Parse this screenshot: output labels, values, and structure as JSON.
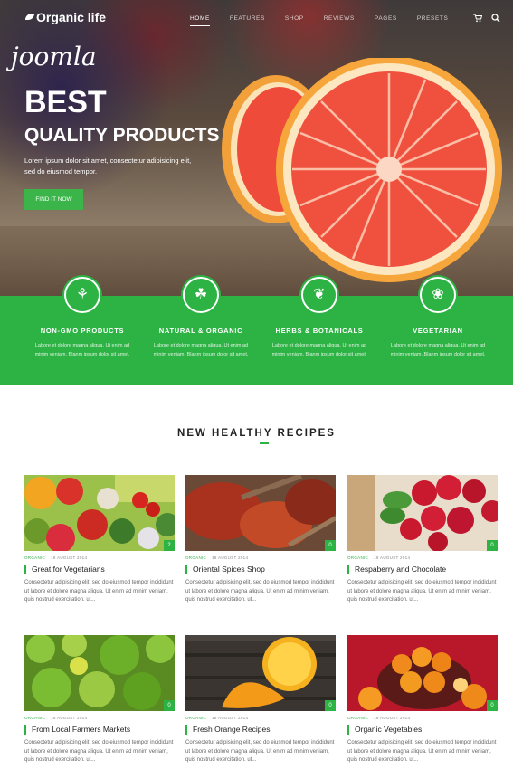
{
  "header": {
    "logo_text": "Organic life",
    "menu": [
      "HOME",
      "FEATURES",
      "SHOP",
      "REVIEWS",
      "PAGES",
      "PRESETS"
    ],
    "icons": [
      "cart-icon",
      "search-icon"
    ]
  },
  "hero": {
    "script_text": "joomla",
    "headline_1": "BEST",
    "headline_2": "QUALITY PRODUCTS",
    "lorem": "Lorem ipsum dolor sit amet, consectetur adipisicing elit, sed do eiusmod tempor.",
    "button": "FIND IT NOW"
  },
  "features": [
    {
      "icon": "sprout-icon",
      "title": "NON-GMO PRODUCTS",
      "text": "Labore et dolore magna aliqua. Ut enim ad minim veniam. Blanm ipsum dolor sit amet."
    },
    {
      "icon": "leaf-bowl-icon",
      "title": "NATURAL & ORGANIC",
      "text": "Labore et dolore magna aliqua. Ut enim ad minim veniam. Blanm ipsum dolor sit amet."
    },
    {
      "icon": "plant-icon",
      "title": "HERBS & BOTANICALS",
      "text": "Labore et dolore magna aliqua. Ut enim ad minim veniam. Blanm ipsum dolor sit amet."
    },
    {
      "icon": "vegetables-icon",
      "title": "VEGETARIAN",
      "text": "Labore et dolore magna aliqua. Ut enim ad minim veniam. Blanm ipsum dolor sit amet."
    }
  ],
  "recipes": {
    "section_title": "NEW HEALTHY RECIPES",
    "cards": [
      {
        "tag": "ORGANIC",
        "date": "18 AUGUST 2014",
        "title": "Great for Vegetarians",
        "badge": "2",
        "text": "Consectetur adipisicing elit, sed do eiusmod tempor incididunt ut labore et dolore magna aliqua. Ut enim ad minim veniam, quis nostrud exercitation. ut..."
      },
      {
        "tag": "ORGANIC",
        "date": "18 AUGUST 2014",
        "title": "Oriental Spices Shop",
        "badge": "0",
        "text": "Consectetur adipisicing elit, sed do eiusmod tempor incididunt ut labore et dolore magna aliqua. Ut enim ad minim veniam, quis nostrud exercitation. ut..."
      },
      {
        "tag": "ORGANIC",
        "date": "18 AUGUST 2014",
        "title": "Respaberry and Chocolate",
        "badge": "0",
        "text": "Consectetur adipisicing elit, sed do eiusmod tempor incididunt ut labore et dolore magna aliqua. Ut enim ad minim veniam, quis nostrud exercitation. ut..."
      },
      {
        "tag": "ORGANIC",
        "date": "18 AUGUST 2014",
        "title": "From Local Farmers Markets",
        "badge": "0",
        "text": "Consectetur adipisicing elit, sed do eiusmod tempor incididunt ut labore et dolore magna aliqua. Ut enim ad minim veniam, quis nostrud exercitation. ut..."
      },
      {
        "tag": "ORGANIC",
        "date": "18 AUGUST 2014",
        "title": "Fresh Orange Recipes",
        "badge": "0",
        "text": "Consectetur adipisicing elit, sed do eiusmod tempor incididunt ut labore et dolore magna aliqua. Ut enim ad minim veniam, quis nostrud exercitation. ut..."
      },
      {
        "tag": "ORGANIC",
        "date": "18 AUGUST 2014",
        "title": "Organic Vegetables",
        "badge": "0",
        "text": "Consectetur adipisicing elit, sed do eiusmod tempor incididunt ut labore et dolore magna aliqua. Ut enim ad minim veniam, quis nostrud exercitation. ut..."
      }
    ]
  },
  "colors": {
    "accent": "#2db244",
    "hero_button": "#3bb54a"
  }
}
